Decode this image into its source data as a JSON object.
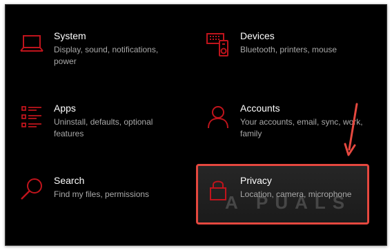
{
  "accent_color": "#c0141c",
  "arrow_color": "#e5483f",
  "tiles": [
    {
      "icon": "laptop-icon",
      "title": "System",
      "description": "Display, sound, notifications, power"
    },
    {
      "icon": "devices-icon",
      "title": "Devices",
      "description": "Bluetooth, printers, mouse"
    },
    {
      "icon": "apps-icon",
      "title": "Apps",
      "description": "Uninstall, defaults, optional features"
    },
    {
      "icon": "person-icon",
      "title": "Accounts",
      "description": "Your accounts, email, sync, work, family"
    },
    {
      "icon": "search-icon",
      "title": "Search",
      "description": "Find my files, permissions"
    },
    {
      "icon": "lock-icon",
      "title": "Privacy",
      "description": "Location, camera, microphone"
    }
  ],
  "watermark": "A PUALS"
}
